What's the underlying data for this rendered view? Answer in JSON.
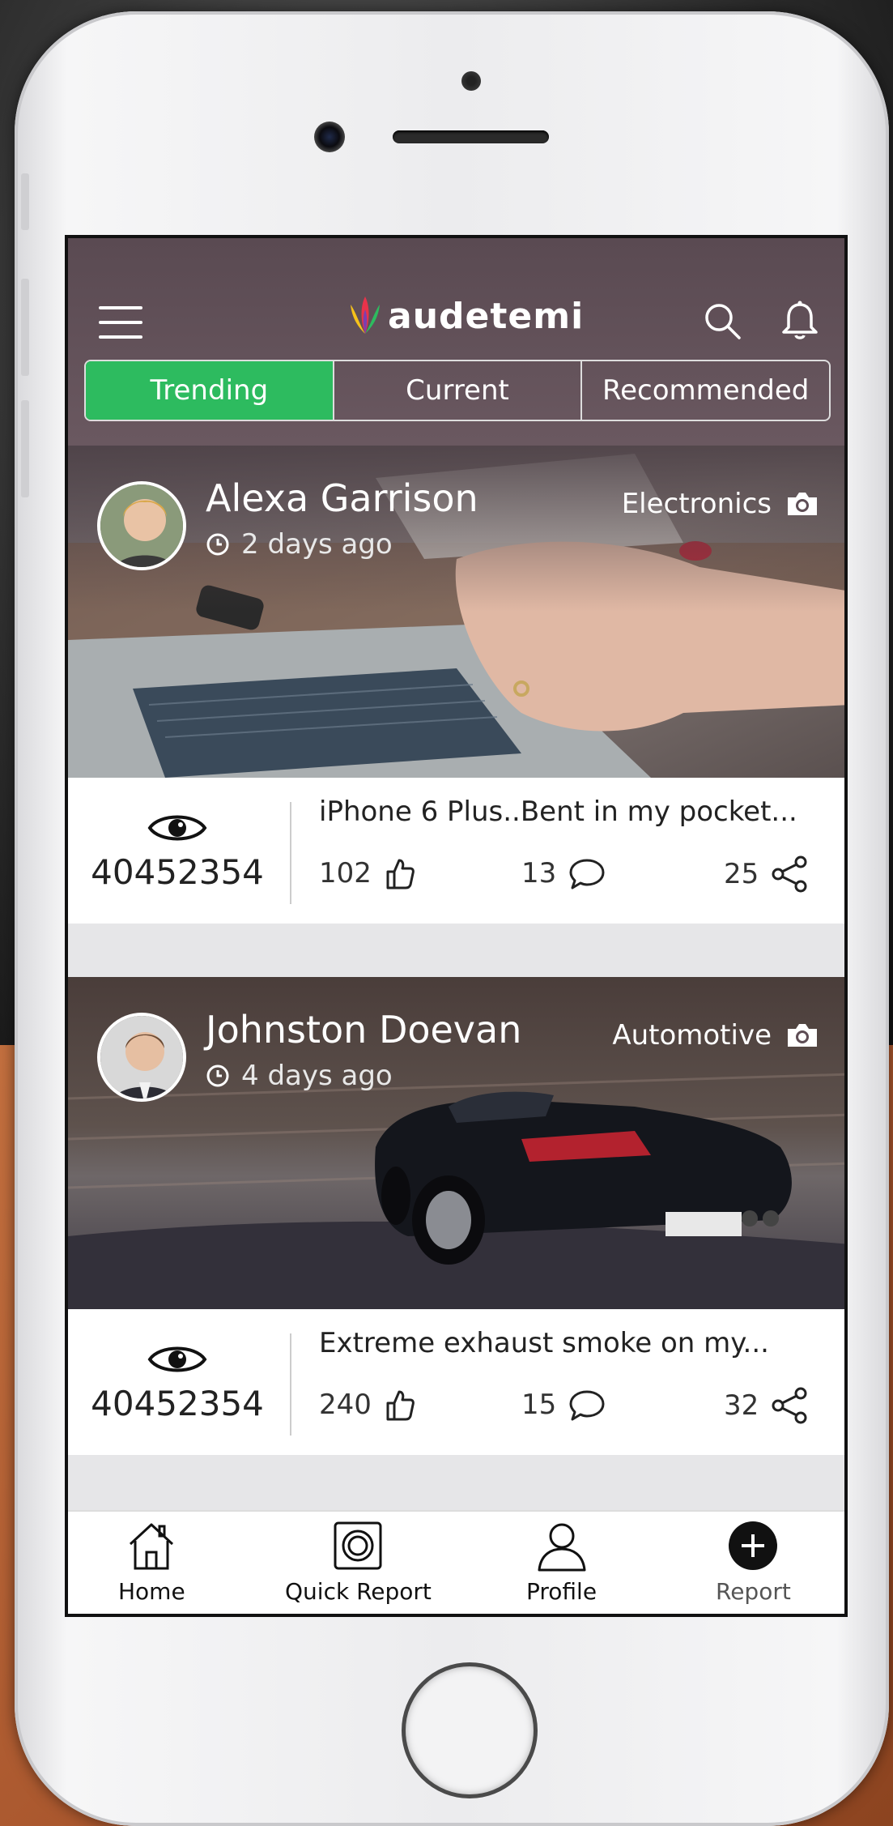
{
  "app": {
    "logo_text": "audetemi",
    "brand_color": "#2dbb5f",
    "header_color": "#5e4d55"
  },
  "tabs": [
    {
      "label": "Trending",
      "active": true
    },
    {
      "label": "Current",
      "active": false
    },
    {
      "label": "Recommended",
      "active": false
    }
  ],
  "posts": [
    {
      "author": "Alexa Garrison",
      "time": "2 days ago",
      "category": "Electronics",
      "views": "40452354",
      "title": "iPhone 6 Plus..Bent in my pocket...",
      "likes": "102",
      "comments": "13",
      "shares": "25"
    },
    {
      "author": "Johnston Doevan",
      "time": "4 days ago",
      "category": "Automotive",
      "views": "40452354",
      "title": "Extreme exhaust smoke on my...",
      "likes": "240",
      "comments": "15",
      "shares": "32"
    }
  ],
  "nav": {
    "home": "Home",
    "quick_report": "Quick Report",
    "profile": "Profile",
    "report": "Report"
  },
  "icons": [
    "hamburger-icon",
    "search-icon",
    "bell-icon",
    "camera-icon",
    "clock-icon",
    "eye-icon",
    "thumbs-up-icon",
    "comment-icon",
    "share-icon",
    "home-icon",
    "quick-report-icon",
    "profile-icon",
    "plus-circle-icon"
  ]
}
